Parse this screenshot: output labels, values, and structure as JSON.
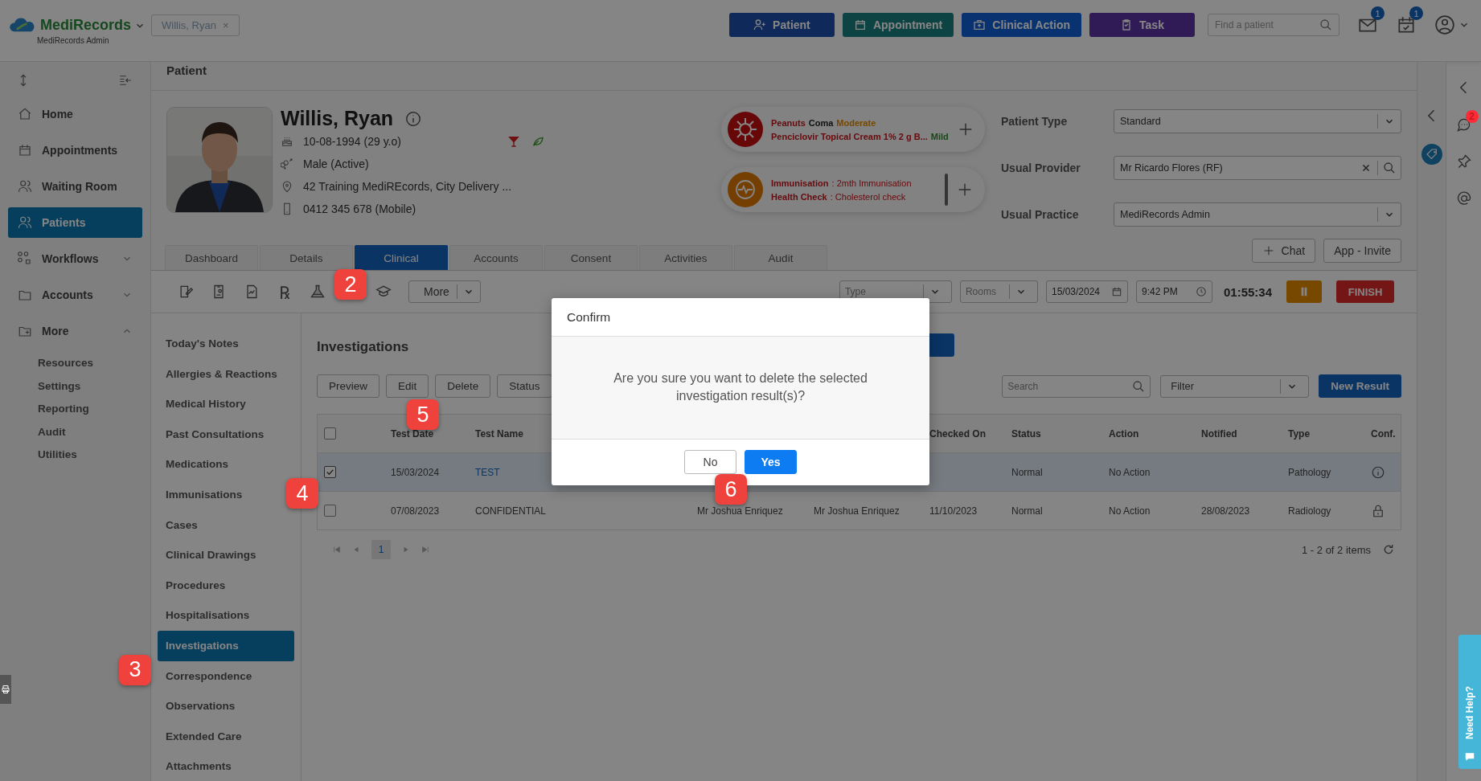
{
  "topbar": {
    "brand": "MediRecords",
    "org": "MediRecords Admin",
    "open_patient": "Willis, Ryan",
    "close_symbol": "×",
    "actions": [
      {
        "label": "Patient"
      },
      {
        "label": "Appointment"
      },
      {
        "label": "Clinical Action"
      },
      {
        "label": "Task"
      }
    ],
    "search": {
      "placeholder": "Find a patient"
    },
    "notifications": [
      {
        "count": "1"
      },
      {
        "count": "1"
      }
    ]
  },
  "sidebar": {
    "items": [
      {
        "label": "Home",
        "selected": false
      },
      {
        "label": "Appointments",
        "selected": false
      },
      {
        "label": "Waiting Room",
        "selected": false
      },
      {
        "label": "Patients",
        "selected": true
      },
      {
        "label": "Workflows",
        "selected": false,
        "expanded": false
      },
      {
        "label": "Accounts",
        "selected": false,
        "expanded": false
      },
      {
        "label": "More",
        "selected": false,
        "expanded": true,
        "children": [
          {
            "label": "Resources"
          },
          {
            "label": "Settings"
          },
          {
            "label": "Reporting"
          },
          {
            "label": "Audit"
          },
          {
            "label": "Utilities"
          }
        ]
      }
    ]
  },
  "page_title": "Patient",
  "patient": {
    "name": "Willis, Ryan",
    "details": [
      "10-08-1994 (29 y.o)",
      "Male (Active)",
      "42 Training MediREcords, City Delivery ...",
      "0412 345 678 (Mobile)"
    ]
  },
  "alerts": [
    {
      "kind": "allergy",
      "lines": [
        {
          "name": "Peanuts",
          "reaction": "Coma",
          "severity": "Moderate"
        },
        {
          "name": "Penciclovir Topical Cream 1% 2 g B...",
          "severity": "Mild"
        }
      ]
    },
    {
      "kind": "reminder",
      "lines": [
        {
          "name": "Immunisation",
          "detail": ": 2mth Immunisation"
        },
        {
          "name": "Health Check",
          "detail": ": Cholesterol check"
        }
      ]
    }
  ],
  "fields": [
    {
      "label": "Patient Type",
      "value": "Standard",
      "kind": "select"
    },
    {
      "label": "Usual Provider",
      "value": "Mr Ricardo Flores (RF)",
      "kind": "lookup"
    },
    {
      "label": "Usual Practice",
      "value": "MediRecords Admin",
      "kind": "select"
    }
  ],
  "header_buttons": [
    {
      "label": "Chat",
      "kind": "add"
    },
    {
      "label": "App - Invite",
      "kind": "plain"
    }
  ],
  "tabs": [
    {
      "label": "Dashboard",
      "selected": false
    },
    {
      "label": "Details",
      "selected": false
    },
    {
      "label": "Clinical",
      "selected": true
    },
    {
      "label": "Accounts",
      "selected": false
    },
    {
      "label": "Consent",
      "selected": false
    },
    {
      "label": "Activities",
      "selected": false
    },
    {
      "label": "Audit",
      "selected": false
    }
  ],
  "toolbar": {
    "rx_symbol": "℞",
    "callout": "2",
    "more": "More",
    "type": {
      "placeholder": "Type"
    },
    "rooms": {
      "placeholder": "Rooms"
    },
    "date": "15/03/2024",
    "time": "9:42 PM",
    "timer": "01:55:34",
    "finish": "FINISH"
  },
  "clinical_nav": [
    {
      "label": "Today's Notes",
      "selected": false
    },
    {
      "label": "Allergies & Reactions",
      "selected": false
    },
    {
      "label": "Medical History",
      "selected": false
    },
    {
      "label": "Past Consultations",
      "selected": false
    },
    {
      "label": "Medications",
      "selected": false
    },
    {
      "label": "Immunisations",
      "selected": false
    },
    {
      "label": "Cases",
      "selected": false
    },
    {
      "label": "Clinical Drawings",
      "selected": false
    },
    {
      "label": "Procedures",
      "selected": false
    },
    {
      "label": "Hospitalisations",
      "selected": false
    },
    {
      "label": "Investigations",
      "selected": true
    },
    {
      "label": "Correspondence",
      "selected": false,
      "callout": "3"
    },
    {
      "label": "Observations",
      "selected": false
    },
    {
      "label": "Extended Care",
      "selected": false
    },
    {
      "label": "Attachments",
      "selected": false
    }
  ],
  "investigations": {
    "title": "Investigations",
    "buttons": [
      {
        "label": "Preview"
      },
      {
        "label": "Edit",
        "callout": "5"
      },
      {
        "label": "Delete"
      },
      {
        "label": "Status"
      }
    ],
    "search": {
      "placeholder": "Search"
    },
    "filter": {
      "placeholder": "Filter"
    },
    "new_result": "New Result",
    "table": {
      "header": {
        "test_date": "Test Date",
        "test_name": "Test Name",
        "checked_on": "Checked On",
        "status": "Status",
        "action": "Action",
        "notified": "Notified",
        "type": "Type",
        "conf": "Conf."
      },
      "all_checked": false,
      "callout": "4",
      "rows": [
        {
          "selected": true,
          "linked": true,
          "confidential": false,
          "test_date": "15/03/2024",
          "test_name": "TEST",
          "status": "Normal",
          "action": "No Action",
          "type": "Pathology"
        },
        {
          "selected": false,
          "linked": false,
          "confidential": true,
          "test_date": "07/08/2023",
          "test_name": "CONFIDENTIAL",
          "column_4": "Mr Joshua Enriquez",
          "column_5": "Mr Joshua Enriquez",
          "checked_on": "11/10/2023",
          "status": "Normal",
          "action": "No Action",
          "notified": "28/08/2023",
          "type": "Radiology"
        }
      ]
    },
    "pager": {
      "pages": [
        {
          "label": "1",
          "selected": true
        }
      ],
      "summary": "1 - 2 of 2 items"
    }
  },
  "dialog": {
    "title": "Confirm",
    "message": "Are you sure you want to delete the selected investigation result(s)?",
    "buttons": [
      {
        "label": "No",
        "kind": "secondary"
      },
      {
        "label": "Yes",
        "kind": "primary",
        "callout": "6"
      }
    ]
  },
  "right_rail": {
    "chat_badge": "2"
  },
  "help_tab": "Need Help?"
}
